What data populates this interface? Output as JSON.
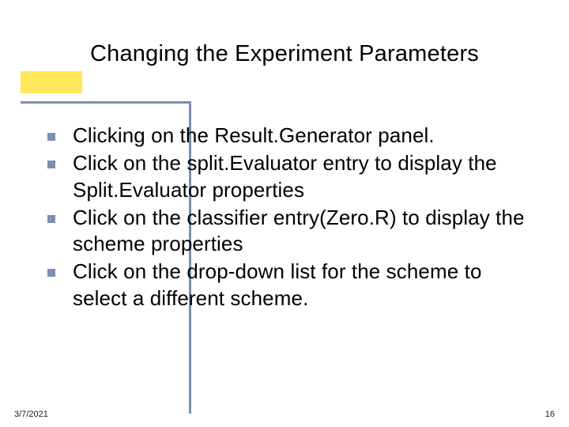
{
  "slide": {
    "title": "Changing the Experiment Parameters",
    "bullets": [
      "Clicking on the Result.Generator panel.",
      "Click on  the split.Evaluator entry to display the Split.Evaluator properties",
      "Click on the classifier entry(Zero.R)  to display the scheme properties",
      "Click on the drop-down list for the scheme to select a different scheme."
    ],
    "footer": {
      "date": "3/7/2021",
      "page": "16"
    }
  }
}
